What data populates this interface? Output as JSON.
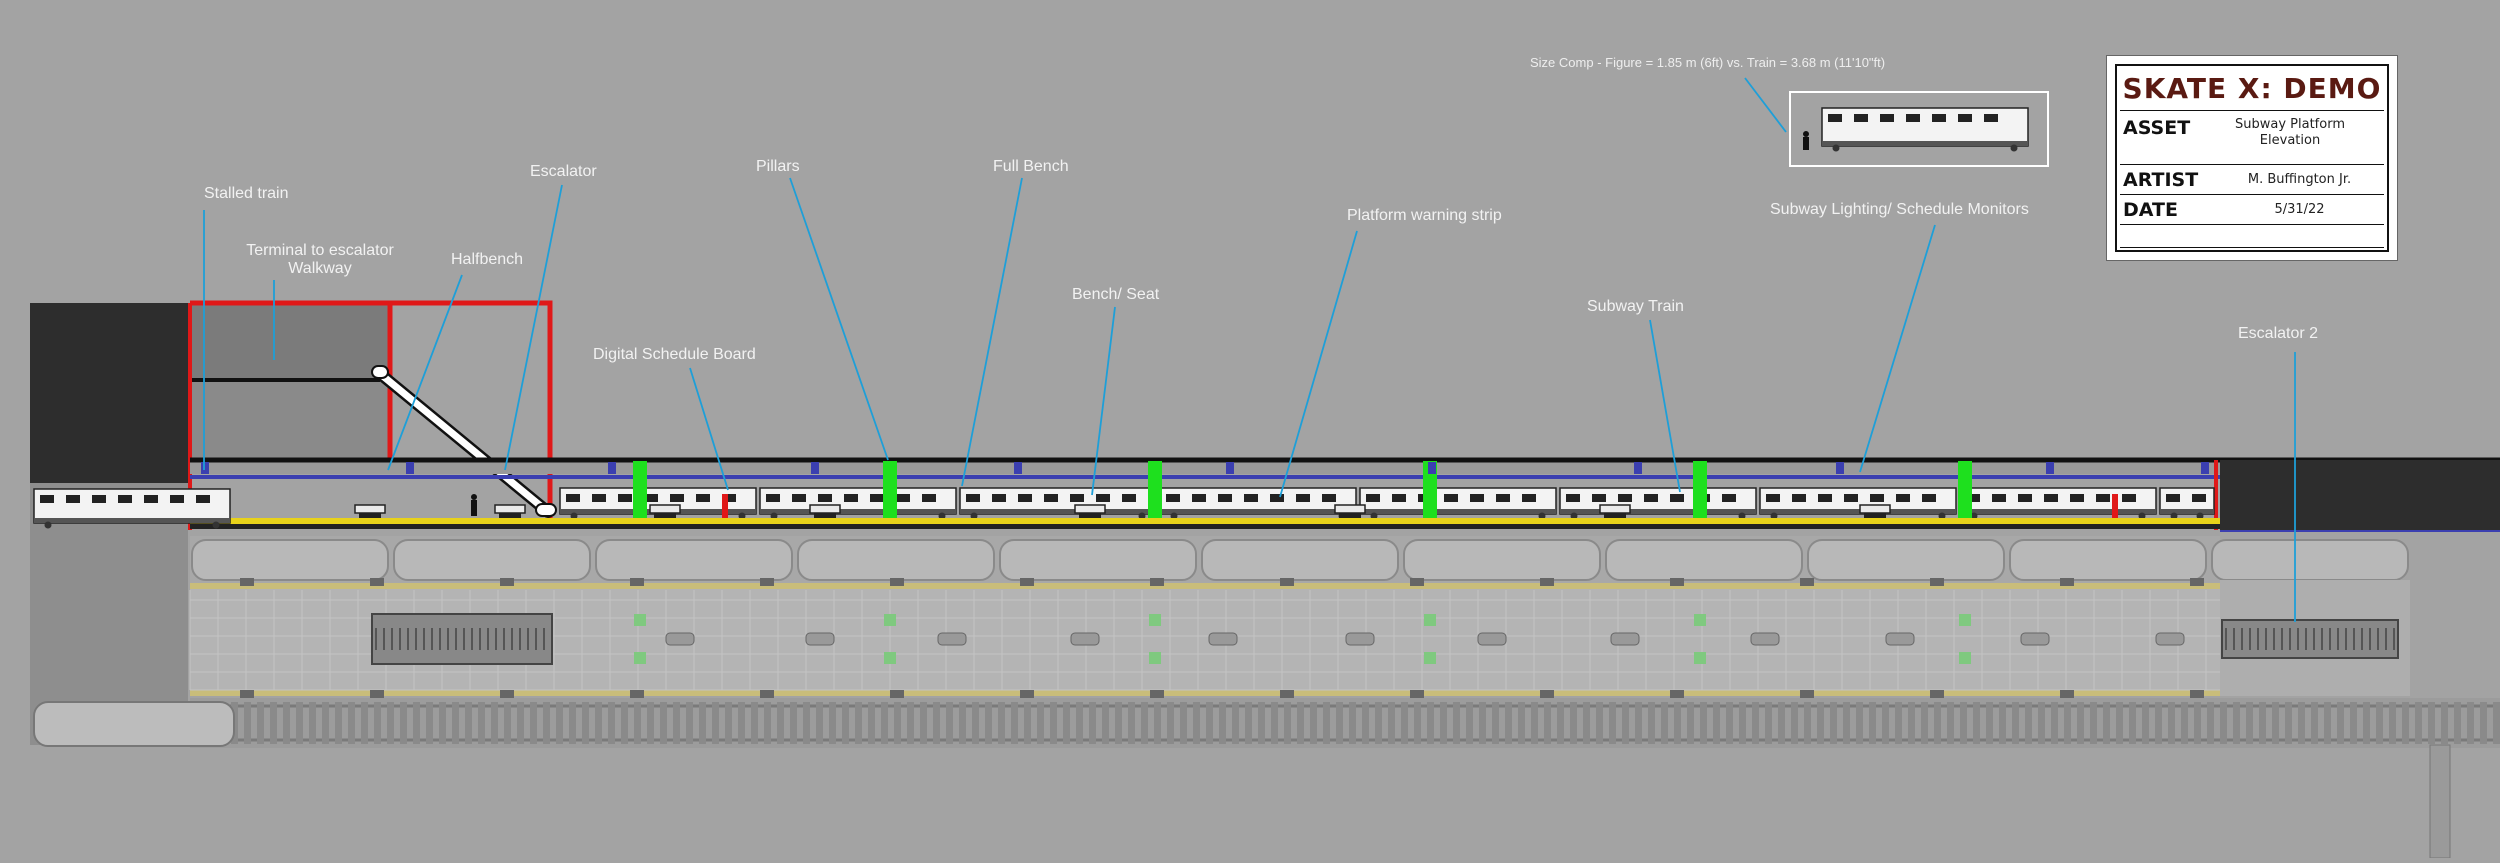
{
  "title_block": {
    "title": "SKATE X: DEMO",
    "asset_label": "ASSET",
    "asset_value": "Subway Platform Elevation",
    "artist_label": "ARTIST",
    "artist_value": "M. Buffington Jr.",
    "date_label": "DATE",
    "date_value": "5/31/22"
  },
  "size_comp": "Size Comp - Figure = 1.85 m (6ft) vs. Train = 3.68 m (11'10\"ft)",
  "callouts": {
    "stalled_train": "Stalled train",
    "terminal_walkway": "Terminal to escalator\nWalkway",
    "halfbench": "Halfbench",
    "escalator": "Escalator",
    "pillars": "Pillars",
    "full_bench": "Full Bench",
    "digital_schedule_board": "Digital Schedule Board",
    "bench_seat": "Bench/ Seat",
    "platform_warning_strip": "Platform warning strip",
    "subway_train": "Subway Train",
    "subway_lighting": "Subway Lighting/ Schedule Monitors",
    "escalator_2": "Escalator 2"
  },
  "colors": {
    "background": "#a3a3a3",
    "callout_line": "#1e9fd8",
    "structure_red": "#e01818",
    "beam_blue": "#3b3fb0",
    "pillar_green": "#1ee01e",
    "warning_strip": "#e8d21a",
    "dark_wall": "#2d2d2d"
  }
}
